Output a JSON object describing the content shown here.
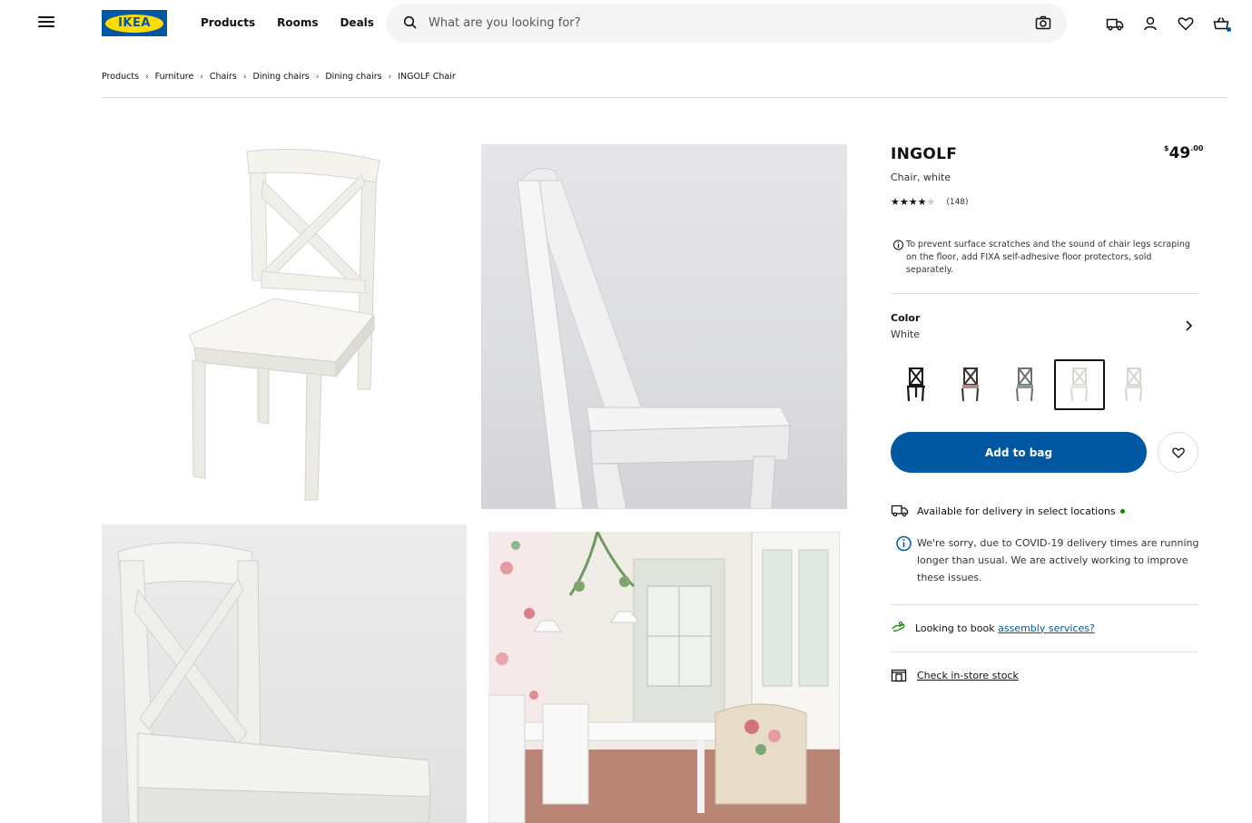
{
  "header": {
    "logo_text": "IKEA",
    "nav": [
      "Products",
      "Rooms",
      "Deals"
    ],
    "search_placeholder": "What are you looking for?"
  },
  "breadcrumb": [
    "Products",
    "Furniture",
    "Chairs",
    "Dining chairs",
    "Dining chairs",
    "INGOLF Chair"
  ],
  "product": {
    "name": "INGOLF",
    "description": "Chair, white",
    "price_currency": "$",
    "price_integer": "49",
    "price_decimal": ".00",
    "rating": 4,
    "rating_max": 5,
    "review_count": "(148)",
    "note": "To prevent surface scratches and the sound of chair legs scraping on the floor, add FIXA self-adhesive floor protectors, sold separately.",
    "color_label": "Color",
    "color_value": "White",
    "swatch_colors": [
      "black",
      "brown-black",
      "gray",
      "white",
      "light-white"
    ],
    "selected_swatch": 3,
    "add_to_bag_label": "Add to bag",
    "delivery_text": "Available for delivery in select locations",
    "covid_text": "We're sorry, due to COVID-19 delivery times are running longer than usual. We are actively working to improve these issues.",
    "assembly_text": "Looking to book ",
    "assembly_link": "assembly services?",
    "stock_link": "Check in-store stock"
  },
  "colors": {
    "brand_blue": "#0058a3",
    "brand_yellow": "#ffdb00",
    "available_green": "#0a8a00"
  }
}
